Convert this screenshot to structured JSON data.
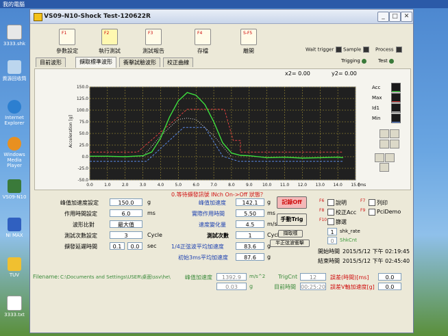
{
  "desktop": {
    "top_label": "我的電腦",
    "icons": [
      {
        "label": "3333.shk"
      },
      {
        "label": "資源回收筒"
      },
      {
        "label": "Internet Explorer"
      },
      {
        "label": "Windows Media Player"
      },
      {
        "label": "VS09-N10"
      },
      {
        "label": "NI MAX"
      },
      {
        "label": "TUV"
      },
      {
        "label": "3333.txt"
      }
    ]
  },
  "window": {
    "title": "VS09-N10-Shock Test-120622R",
    "buttons": {
      "min": "_",
      "max": "□",
      "close": "✕"
    }
  },
  "toolbar": {
    "items": [
      {
        "label": "參數設定",
        "tag": "F1"
      },
      {
        "label": "執行測試",
        "tag": "F2"
      },
      {
        "label": "測試報告",
        "tag": "F3"
      },
      {
        "label": "存檔",
        "tag": "F4"
      },
      {
        "label": "離開",
        "tag": "S-F5"
      }
    ],
    "indicators": [
      {
        "label": "Wait trigger"
      },
      {
        "label": "Sample"
      },
      {
        "label": "Process"
      }
    ]
  },
  "tabs": [
    {
      "label": "目前波形"
    },
    {
      "label": "擷取標準波形"
    },
    {
      "label": "衝擊試驗波形"
    },
    {
      "label": "校正曲線"
    }
  ],
  "trigger": {
    "trigging": "Trigging",
    "test": "Test"
  },
  "cursor": {
    "x2": "x2= 0.00",
    "y2": "y2= 0.00"
  },
  "chart_data": {
    "type": "line",
    "ylabel": "Acceleration [g]",
    "xlabel": "[msec]",
    "xlim": [
      0,
      15
    ],
    "ylim": [
      -50,
      150
    ],
    "x_ticks": [
      "0.0",
      "1.0",
      "2.0",
      "3.0",
      "4.0",
      "5.0",
      "6.0",
      "7.0",
      "8.0",
      "9.0",
      "10.0",
      "11.0",
      "12.0",
      "13.0",
      "14.0",
      "15.0"
    ],
    "y_ticks": [
      "150.0",
      "125.0",
      "100.0",
      "75.0",
      "50.0",
      "25.0",
      "0.0",
      "-25.0",
      "-50.0"
    ],
    "grid": true,
    "legend_position": "right",
    "series": [
      {
        "name": "Acc",
        "color": "#3fe03f",
        "points": [
          [
            0,
            1
          ],
          [
            1,
            1
          ],
          [
            2,
            0
          ],
          [
            3,
            2
          ],
          [
            3.5,
            10
          ],
          [
            4,
            40
          ],
          [
            4.5,
            85
          ],
          [
            5,
            120
          ],
          [
            5.5,
            138
          ],
          [
            6,
            132
          ],
          [
            6.5,
            112
          ],
          [
            7,
            75
          ],
          [
            7.5,
            30
          ],
          [
            8,
            8
          ],
          [
            8.5,
            3
          ],
          [
            9,
            2
          ],
          [
            10,
            -2
          ],
          [
            11,
            -1
          ],
          [
            12,
            -3
          ],
          [
            13,
            -2
          ],
          [
            14,
            -1
          ],
          [
            14.3,
            -2
          ]
        ]
      },
      {
        "name": "Max",
        "color": "#e04040",
        "points": [
          [
            0,
            10
          ],
          [
            2.7,
            10
          ],
          [
            5.5,
            102
          ],
          [
            7.6,
            102
          ],
          [
            8.1,
            35
          ],
          [
            8.5,
            35
          ],
          [
            8.5,
            10
          ],
          [
            14.3,
            10
          ]
        ]
      },
      {
        "name": "Min",
        "color": "#5a8ae8",
        "points": [
          [
            0,
            -10
          ],
          [
            3.2,
            -10
          ],
          [
            5.3,
            63
          ],
          [
            6.5,
            63
          ],
          [
            7.5,
            1
          ],
          [
            8.4,
            -10
          ],
          [
            14.3,
            -10
          ]
        ]
      },
      {
        "name": "Id1",
        "color": "#d8d8d8",
        "points": [
          [
            3.0,
            0
          ],
          [
            4.0,
            45
          ],
          [
            5.0,
            80
          ],
          [
            5.5,
            83
          ],
          [
            6.0,
            80
          ],
          [
            7.0,
            45
          ],
          [
            8.0,
            0
          ]
        ]
      }
    ]
  },
  "settings": {
    "rows": [
      {
        "label": "峰值加速度設定",
        "value": "150.0",
        "unit": "g"
      },
      {
        "label": "作用時間設定",
        "value": "6.0",
        "unit": "ms"
      },
      {
        "label": "波形比對",
        "value": "最大值",
        "unit": ""
      },
      {
        "label": "測試次數設定",
        "value": "3",
        "unit": "Cycle"
      },
      {
        "label": "擷發延遲時間",
        "value": "0.1",
        "value2": "0.0",
        "unit": "sec"
      }
    ]
  },
  "status_msg": "0.等待擷發訊號 INch On->Off 狀態？",
  "results": {
    "rows": [
      {
        "label": "峰值加速度",
        "value": "142.1",
        "unit": "g"
      },
      {
        "label": "實際作用時間",
        "value": "5.50",
        "unit": "ms"
      },
      {
        "label": "速度變化量",
        "value": "4.5",
        "unit": "m/s"
      },
      {
        "label": "測試次數",
        "value": "1",
        "unit": "Cycle"
      },
      {
        "label": "1/4正弦波平均加速度",
        "value": "83.6",
        "unit": "g"
      },
      {
        "label": "初始3ms平均加速度",
        "value": "87.6",
        "unit": "g"
      }
    ]
  },
  "actions": {
    "record_off": "記錄Off",
    "manual_trig": "手動Trig",
    "capture_wave": "擷取樣",
    "half_sine": "半正弦波衝擊"
  },
  "options": {
    "tags": [
      "F6",
      "F7",
      "F8",
      "F9",
      "F10",
      "F11",
      "F12"
    ],
    "items": [
      {
        "label": "說明",
        "checked": false
      },
      {
        "label": "列印",
        "checked": false
      },
      {
        "label": "校正Acc",
        "checked": false
      },
      {
        "label": "PciDemo",
        "checked": false
      },
      {
        "label": "篩選",
        "checked": false
      }
    ],
    "shk_rate_value": "1",
    "shk_rate_label": "shk_rate",
    "shk_cnt_value": "0",
    "shk_cnt_label": "ShkCnt"
  },
  "times": {
    "start_label": "開始時間",
    "start_value": "2015/5/12 下午 02:19:45",
    "end_label": "結束時間",
    "end_value": "2015/5/12 下午 02:45:40"
  },
  "statusbar": {
    "filename_label": "Filename:",
    "filename_value": "C:\\Documents and Settings\\USER\\桌面\\ssv\\he\\",
    "peak_label": "峰值加速度",
    "peak_value": "1392.9",
    "peak_unit": "m/s^2",
    "v2": "0.03",
    "v2_unit": "g",
    "trig_label": "TrigCnt",
    "trig_value": "12",
    "time_label": "目前時間",
    "time_value": "00:25:20",
    "err1_label": "誤差(時間)[ms]",
    "err1_value": "0.0",
    "err2_label": "誤差V軸加速度[g]",
    "err2_value": "0.0"
  },
  "colors": {
    "accent_red": "#d01010",
    "accent_blue": "#1a3fb0",
    "plot_bg": "#202020",
    "grid": "#b8a43a"
  }
}
